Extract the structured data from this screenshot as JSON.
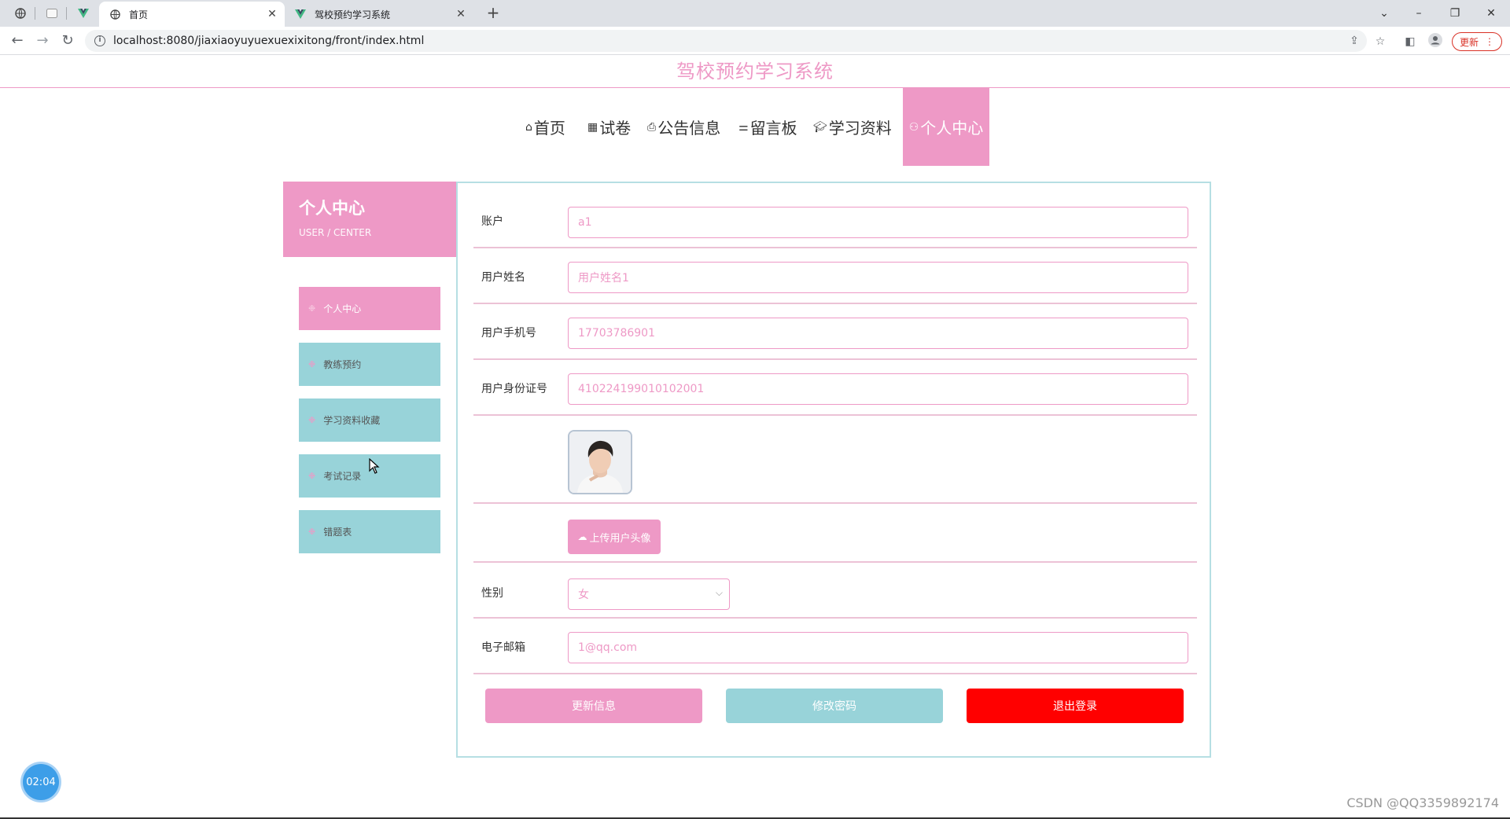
{
  "browser": {
    "tabs": [
      {
        "label": "首页",
        "active": true
      },
      {
        "label": "驾校预约学习系统",
        "active": false
      }
    ],
    "url": "localhost:8080/jiaxiaoyuyuexuexixitong/front/index.html",
    "update_label": "更新"
  },
  "site": {
    "title": "驾校预约学习系统"
  },
  "nav": {
    "items": [
      {
        "label": "首页",
        "icon": "home-icon"
      },
      {
        "label": "试卷",
        "icon": "grid-icon"
      },
      {
        "label": "公告信息",
        "icon": "printer-icon"
      },
      {
        "label": "留言板",
        "icon": "sliders-icon"
      },
      {
        "label": "学习资料",
        "icon": "graduation-cap-icon"
      },
      {
        "label": "个人中心",
        "icon": "user-icon",
        "active": true
      }
    ]
  },
  "sidebar": {
    "title": "个人中心",
    "subtitle": "USER / CENTER",
    "items": [
      {
        "label": "个人中心"
      },
      {
        "label": "教练预约"
      },
      {
        "label": "学习资料收藏"
      },
      {
        "label": "考试记录"
      },
      {
        "label": "错题表"
      }
    ]
  },
  "form": {
    "account": {
      "label": "账户",
      "value": "a1"
    },
    "name": {
      "label": "用户姓名",
      "value": "用户姓名1"
    },
    "phone": {
      "label": "用户手机号",
      "value": "17703786901"
    },
    "id_card": {
      "label": "用户身份证号",
      "value": "410224199010102001"
    },
    "upload_label": "上传用户头像",
    "gender": {
      "label": "性别",
      "value": "女"
    },
    "email": {
      "label": "电子邮箱",
      "value": "1@qq.com"
    }
  },
  "actions": {
    "update": "更新信息",
    "change_password": "修改密码",
    "logout": "退出登录"
  },
  "timer": "02:04",
  "watermark": "CSDN @QQ3359892174",
  "colors": {
    "pink": "#ee99c6",
    "teal": "#98d3d9",
    "red": "#ff0000",
    "panel_border": "#b6dfe3"
  }
}
